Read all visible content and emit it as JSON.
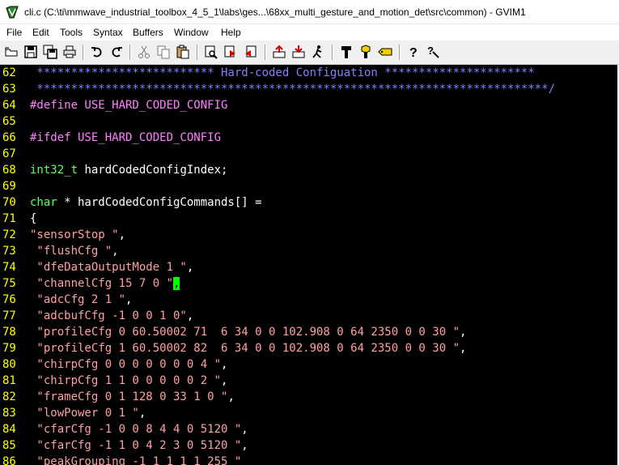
{
  "window": {
    "title": "cli.c (C:\\ti\\mmwave_industrial_toolbox_4_5_1\\labs\\ges...\\68xx_multi_gesture_and_motion_det\\src\\common) - GVIM1"
  },
  "menu": [
    "File",
    "Edit",
    "Tools",
    "Syntax",
    "Buffers",
    "Window",
    "Help"
  ],
  "toolbar_icons": [
    "open-icon",
    "save-icon",
    "save-all-icon",
    "print-icon",
    "undo-icon",
    "redo-icon",
    "cut-icon",
    "copy-icon",
    "paste-icon",
    "find-icon",
    "find-next-icon",
    "find-prev-icon",
    "load-session-icon",
    "save-session-icon",
    "run-script-icon",
    "make-icon",
    "shell-icon",
    "tag-icon",
    "help-icon",
    "find-help-icon"
  ],
  "editor": {
    "lines": [
      {
        "num": "62",
        "parts": [
          {
            "c": "c-comment",
            "t": " ************************** Hard-coded Configuation **********************"
          }
        ]
      },
      {
        "num": "63",
        "parts": [
          {
            "c": "c-comment",
            "t": " ***************************************************************************/"
          }
        ]
      },
      {
        "num": "64",
        "parts": [
          {
            "c": "c-preproc",
            "t": "#define USE_HARD_CODED_CONFIG"
          }
        ]
      },
      {
        "num": "65",
        "parts": []
      },
      {
        "num": "66",
        "parts": [
          {
            "c": "c-preproc",
            "t": "#ifdef USE_HARD_CODED_CONFIG"
          }
        ]
      },
      {
        "num": "67",
        "parts": []
      },
      {
        "num": "68",
        "parts": [
          {
            "c": "c-type",
            "t": "int32_t"
          },
          {
            "c": "c-normal",
            "t": " hardCodedConfigIndex;"
          }
        ]
      },
      {
        "num": "69",
        "parts": []
      },
      {
        "num": "70",
        "parts": [
          {
            "c": "c-type",
            "t": "char"
          },
          {
            "c": "c-normal",
            "t": " * hardCodedConfigCommands[] ="
          }
        ]
      },
      {
        "num": "71",
        "parts": [
          {
            "c": "c-normal",
            "t": "{"
          }
        ]
      },
      {
        "num": "72",
        "parts": [
          {
            "c": "c-string",
            "t": "\"sensorStop \""
          },
          {
            "c": "c-normal",
            "t": ","
          }
        ]
      },
      {
        "num": "73",
        "parts": [
          {
            "c": "c-string",
            "t": " \"flushCfg \""
          },
          {
            "c": "c-normal",
            "t": ","
          }
        ]
      },
      {
        "num": "74",
        "parts": [
          {
            "c": "c-string",
            "t": " \"dfeDataOutputMode 1 \""
          },
          {
            "c": "c-normal",
            "t": ","
          }
        ]
      },
      {
        "num": "75",
        "parts": [
          {
            "c": "c-string",
            "t": " \"channelCfg 15 7 0 \""
          },
          {
            "c": "cursor",
            "t": ","
          }
        ]
      },
      {
        "num": "76",
        "parts": [
          {
            "c": "c-string",
            "t": " \"adcCfg 2 1 \""
          },
          {
            "c": "c-normal",
            "t": ","
          }
        ]
      },
      {
        "num": "77",
        "parts": [
          {
            "c": "c-string",
            "t": " \"adcbufCfg -1 0 0 1 0\""
          },
          {
            "c": "c-normal",
            "t": ","
          }
        ]
      },
      {
        "num": "78",
        "parts": [
          {
            "c": "c-string",
            "t": " \"profileCfg 0 60.50002 71  6 34 0 0 102.908 0 64 2350 0 0 30 \""
          },
          {
            "c": "c-normal",
            "t": ","
          }
        ]
      },
      {
        "num": "79",
        "parts": [
          {
            "c": "c-string",
            "t": " \"profileCfg 1 60.50002 82  6 34 0 0 102.908 0 64 2350 0 0 30 \""
          },
          {
            "c": "c-normal",
            "t": ","
          }
        ]
      },
      {
        "num": "80",
        "parts": [
          {
            "c": "c-string",
            "t": " \"chirpCfg 0 0 0 0 0 0 0 4 \""
          },
          {
            "c": "c-normal",
            "t": ","
          }
        ]
      },
      {
        "num": "81",
        "parts": [
          {
            "c": "c-string",
            "t": " \"chirpCfg 1 1 0 0 0 0 0 2 \""
          },
          {
            "c": "c-normal",
            "t": ","
          }
        ]
      },
      {
        "num": "82",
        "parts": [
          {
            "c": "c-string",
            "t": " \"frameCfg 0 1 128 0 33 1 0 \""
          },
          {
            "c": "c-normal",
            "t": ","
          }
        ]
      },
      {
        "num": "83",
        "parts": [
          {
            "c": "c-string",
            "t": " \"lowPower 0 1 \""
          },
          {
            "c": "c-normal",
            "t": ","
          }
        ]
      },
      {
        "num": "84",
        "parts": [
          {
            "c": "c-string",
            "t": " \"cfarCfg -1 0 0 8 4 4 0 5120 \""
          },
          {
            "c": "c-normal",
            "t": ","
          }
        ]
      },
      {
        "num": "85",
        "parts": [
          {
            "c": "c-string",
            "t": " \"cfarCfg -1 1 0 4 2 3 0 5120 \""
          },
          {
            "c": "c-normal",
            "t": ","
          }
        ]
      },
      {
        "num": "86",
        "parts": [
          {
            "c": "c-string",
            "t": " \"peakGrouping -1 1 1 1 1 255 \""
          }
        ]
      }
    ]
  }
}
